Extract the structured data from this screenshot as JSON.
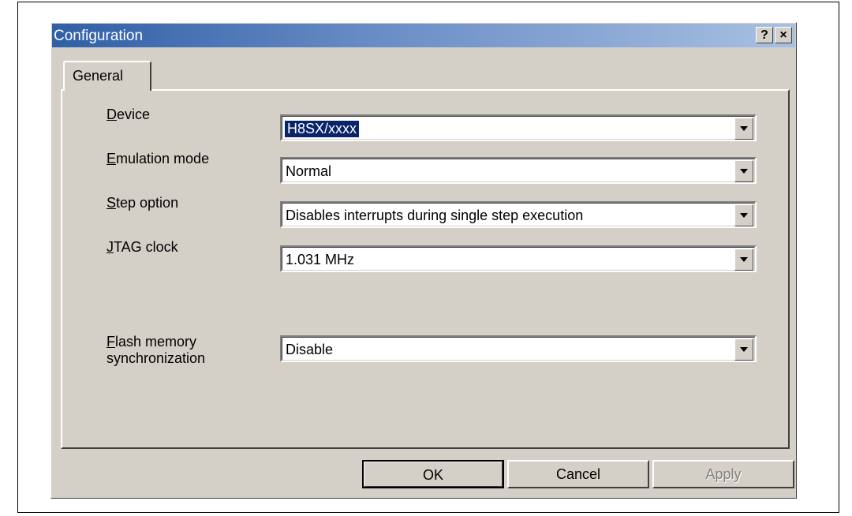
{
  "dialog": {
    "title": "Configuration",
    "help_button": "?",
    "close_button": "×"
  },
  "tabs": [
    {
      "label": "General",
      "active": true
    }
  ],
  "fields": {
    "device": {
      "label": "Device",
      "mnemonic": "D",
      "value": "H8SX/xxxx"
    },
    "emulation_mode": {
      "label": "Emulation mode",
      "mnemonic": "E",
      "value": "Normal"
    },
    "step_option": {
      "label": "Step option",
      "mnemonic": "S",
      "value": "Disables interrupts during single step execution"
    },
    "jtag_clock": {
      "label": "JTAG clock",
      "mnemonic": "J",
      "value": "1.031 MHz"
    },
    "flash_sync": {
      "label_line1": "Flash memory",
      "label_line2": "synchronization",
      "mnemonic": "F",
      "value": "Disable"
    }
  },
  "buttons": {
    "ok": "OK",
    "cancel": "Cancel",
    "apply": "Apply"
  },
  "colors": {
    "dialog_bg": "#d4d0c8",
    "title_start": "#2f5fa6",
    "title_end": "#a8c0e2",
    "selection": "#0a246a"
  }
}
